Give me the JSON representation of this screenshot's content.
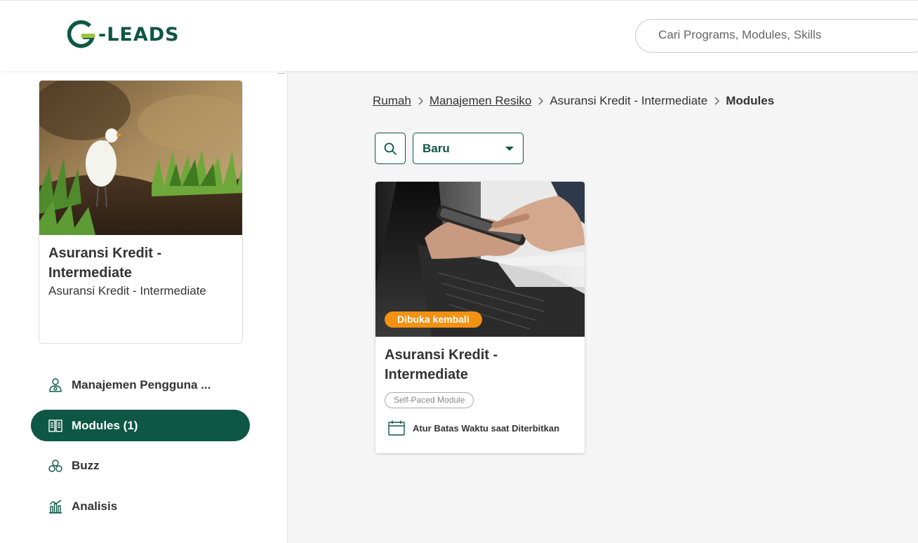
{
  "brand": {
    "logo_text": "-LEADS",
    "logo_letter": "G",
    "primary_color": "#0d5744",
    "accent_color": "#f39113",
    "logo_bar_color": "#9bc43c"
  },
  "header": {
    "search_placeholder": "Cari Programs, Modules, Skills"
  },
  "sidebar": {
    "course": {
      "title": "Asuransi Kredit - Intermediate",
      "subtitle": "Asuransi Kredit - Intermediate",
      "image": "egret-in-field-photo"
    },
    "nav": [
      {
        "label": "Manajemen Pengguna ...",
        "icon": "user-manage-icon",
        "active": false
      },
      {
        "label": "Modules (1)",
        "icon": "module-book-icon",
        "active": true
      },
      {
        "label": "Buzz",
        "icon": "buzz-icon",
        "active": false
      },
      {
        "label": "Analisis",
        "icon": "analytics-icon",
        "active": false
      }
    ]
  },
  "breadcrumb": {
    "items": [
      "Rumah",
      "Manajemen Resiko",
      "Asuransi Kredit - Intermediate"
    ],
    "current": "Modules"
  },
  "toolbar": {
    "sort_value": "Baru",
    "search_icon": "search-icon"
  },
  "modules": [
    {
      "badge": "Dibuka kembali",
      "title": "Asuransi Kredit - Intermediate",
      "tag": "Self-Paced Module",
      "due_text": "Atur Batas Waktu saat Diterbitkan",
      "image": "hand-on-phone-laptop-photo"
    }
  ]
}
